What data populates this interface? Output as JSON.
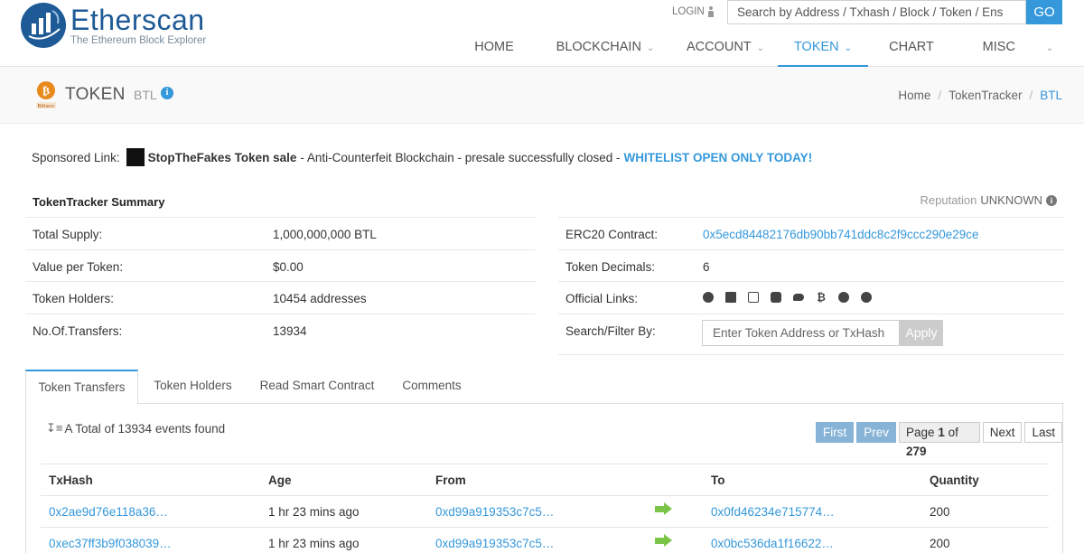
{
  "header": {
    "brand_name": "Etherscan",
    "brand_tagline": "The Ethereum Block Explorer",
    "login_label": "LOGIN",
    "search_placeholder": "Search by Address / Txhash / Block / Token / Ens",
    "go_label": "GO",
    "nav": [
      {
        "label": "HOME",
        "dropdown": false,
        "active": false
      },
      {
        "label": "BLOCKCHAIN",
        "dropdown": true,
        "active": false
      },
      {
        "label": "ACCOUNT",
        "dropdown": true,
        "active": false
      },
      {
        "label": "TOKEN",
        "dropdown": true,
        "active": true
      },
      {
        "label": "CHART",
        "dropdown": false,
        "active": false
      },
      {
        "label": "MISC",
        "dropdown": true,
        "active": false
      }
    ],
    "accent_color": "#3498db"
  },
  "title": {
    "label": "TOKEN",
    "symbol": "BTL",
    "logo_caption": "Bitlanc",
    "breadcrumb": [
      "Home",
      "TokenTracker",
      "BTL"
    ]
  },
  "sponsored": {
    "prefix": "Sponsored Link:",
    "name": "StopTheFakes Token sale",
    "text": "- Anti-Counterfeit Blockchain - presale successfully closed -",
    "cta": "WHITELIST OPEN ONLY TODAY!"
  },
  "summary": {
    "heading": "TokenTracker Summary",
    "reputation_label": "Reputation",
    "reputation_value": "UNKNOWN",
    "left": [
      {
        "key": "Total Supply:",
        "value": "1,000,000,000 BTL"
      },
      {
        "key": "Value per Token:",
        "value": "$0.00"
      },
      {
        "key": "Token Holders:",
        "value": "10454 addresses"
      },
      {
        "key": "No.Of.Transfers:",
        "value": "13934"
      }
    ],
    "right": {
      "contract_key": "ERC20 Contract:",
      "contract_value": "0x5ecd84482176db90bb741ddc8c2f9ccc290e29ce",
      "decimals_key": "Token Decimals:",
      "decimals_value": "6",
      "links_key": "Official Links:",
      "filter_key": "Search/Filter By:",
      "filter_placeholder": "Enter Token Address or TxHash",
      "apply_label": "Apply"
    }
  },
  "tabs": [
    "Token Transfers",
    "Token Holders",
    "Read Smart Contract",
    "Comments"
  ],
  "transfers": {
    "found_text": "A Total of 13934 events found",
    "pager": {
      "first": "First",
      "prev": "Prev",
      "page_prefix": "Page",
      "page": "1",
      "of": "of",
      "total": "279",
      "next": "Next",
      "last": "Last"
    },
    "columns": [
      "TxHash",
      "Age",
      "From",
      "",
      "To",
      "Quantity"
    ],
    "rows": [
      {
        "hash": "0x2ae9d76e118a36…",
        "age": "1 hr 23 mins ago",
        "from": "0xd99a919353c7c5…",
        "to": "0x0fd46234e715774…",
        "qty": "200"
      },
      {
        "hash": "0xec37ff3b9f038039…",
        "age": "1 hr 23 mins ago",
        "from": "0xd99a919353c7c5…",
        "to": "0x0bc536da1f16622…",
        "qty": "200"
      }
    ]
  }
}
